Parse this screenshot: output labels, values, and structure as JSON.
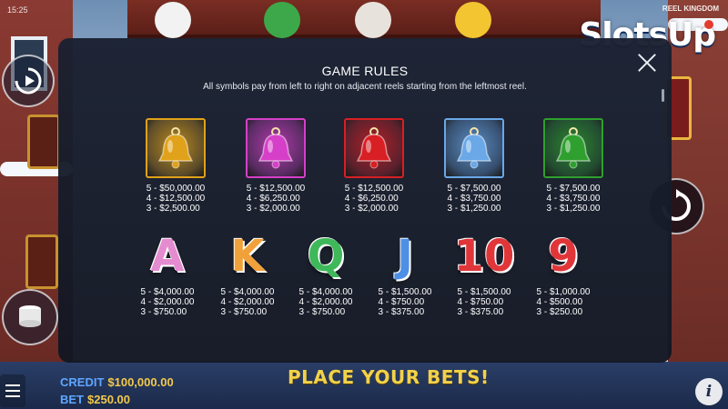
{
  "status_time": "15:25",
  "game_title": "REEL KINGDOM",
  "brand": {
    "name": "SlotsUp"
  },
  "modal": {
    "title": "GAME RULES",
    "subtitle": "All symbols pay from left to right on adjacent reels starting from the leftmost reel."
  },
  "symbols_row1": [
    {
      "icon": "gold-bell-icon",
      "color": "#e0a21a",
      "pays": [
        "5 - $50,000.00",
        "4 - $12,500.00",
        "3 - $2,500.00"
      ]
    },
    {
      "icon": "pink-bell-icon",
      "color": "#d63fc8",
      "pays": [
        "5 - $12,500.00",
        "4 - $6,250.00",
        "3 - $2,000.00"
      ]
    },
    {
      "icon": "red-bell-icon",
      "color": "#d81f24",
      "pays": [
        "5 - $12,500.00",
        "4 - $6,250.00",
        "3 - $2,000.00"
      ]
    },
    {
      "icon": "blue-bell-icon",
      "color": "#6aa8e8",
      "pays": [
        "5 - $7,500.00",
        "4 - $3,750.00",
        "3 - $1,250.00"
      ]
    },
    {
      "icon": "green-bell-icon",
      "color": "#2fa02f",
      "pays": [
        "5 - $7,500.00",
        "4 - $3,750.00",
        "3 - $1,250.00"
      ]
    }
  ],
  "symbols_row2": [
    {
      "icon": "letter-a-icon",
      "glyph": "A",
      "color": "#e58bd0",
      "pays": [
        "5 - $4,000.00",
        "4 - $2,000.00",
        "3 - $750.00"
      ]
    },
    {
      "icon": "letter-k-icon",
      "glyph": "K",
      "color": "#f0a13a",
      "pays": [
        "5 - $4,000.00",
        "4 - $2,000.00",
        "3 - $750.00"
      ]
    },
    {
      "icon": "letter-q-icon",
      "glyph": "Q",
      "color": "#3fb85a",
      "pays": [
        "5 - $4,000.00",
        "4 - $2,000.00",
        "3 - $750.00"
      ]
    },
    {
      "icon": "letter-j-icon",
      "glyph": "J",
      "color": "#4e8fe6",
      "pays": [
        "5 - $1,500.00",
        "4 - $750.00",
        "3 - $375.00"
      ]
    },
    {
      "icon": "number-10-icon",
      "glyph": "10",
      "color": "#e0363a",
      "pays": [
        "5 - $1,500.00",
        "4 - $750.00",
        "3 - $375.00"
      ]
    },
    {
      "icon": "number-9-icon",
      "glyph": "9",
      "color": "#e0363a",
      "pays": [
        "5 - $1,000.00",
        "4 - $500.00",
        "3 - $250.00"
      ]
    }
  ],
  "footer": {
    "credit_label": "CREDIT",
    "credit_value": "$100,000.00",
    "bet_label": "BET",
    "bet_value": "$250.00",
    "place_bets": "PLACE YOUR BETS!"
  }
}
